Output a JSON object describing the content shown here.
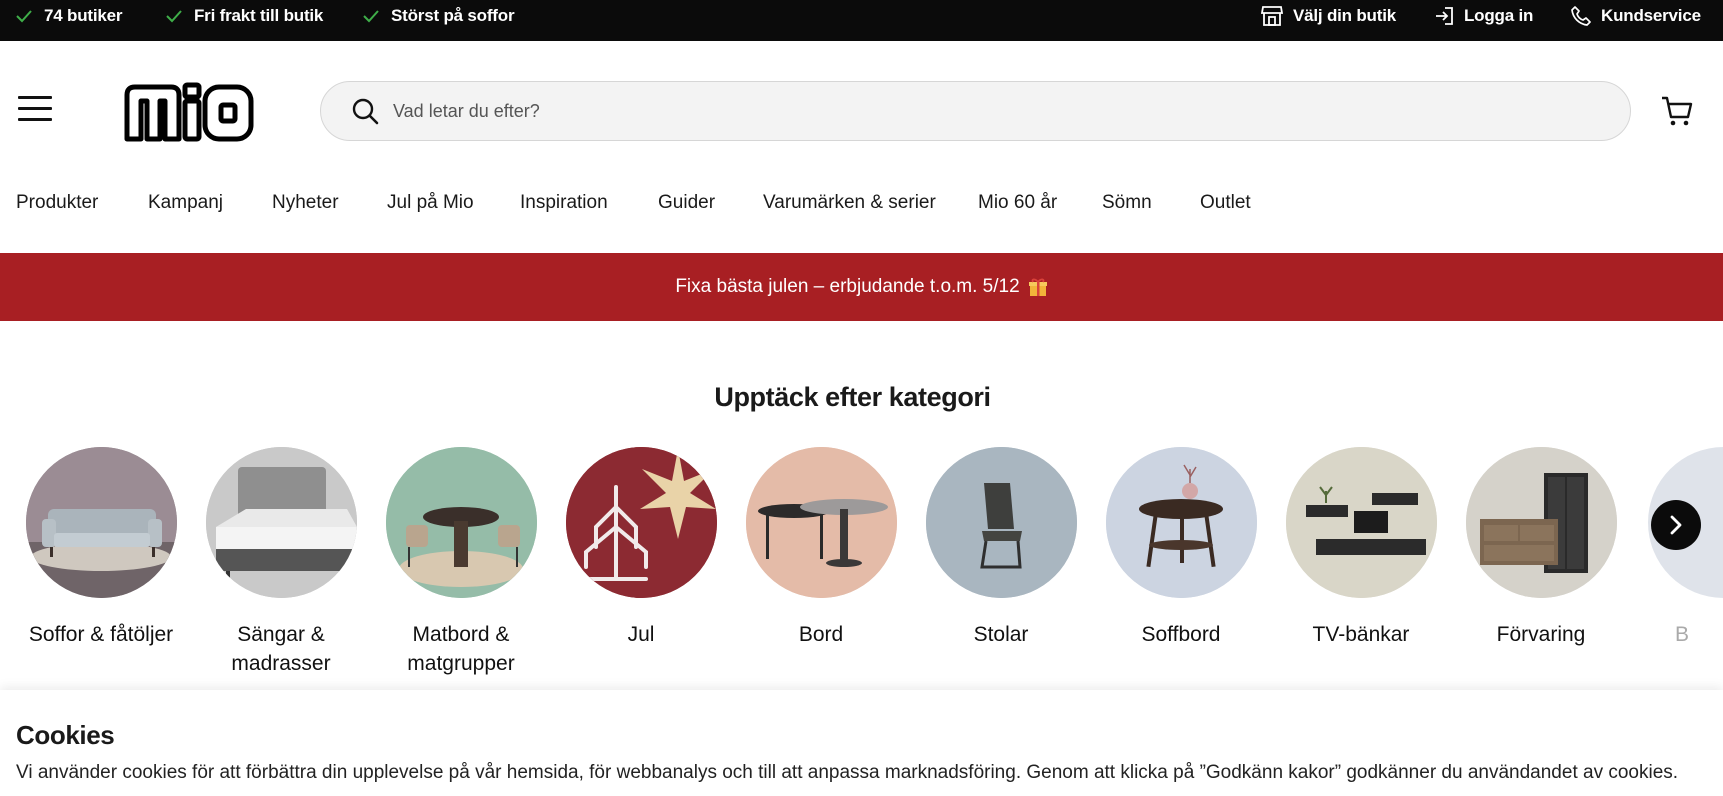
{
  "topbar": {
    "usps": [
      "74 butiker",
      "Fri frakt till butik",
      "Störst på soffor"
    ],
    "links": {
      "store": "Välj din butik",
      "login": "Logga in",
      "service": "Kundservice"
    }
  },
  "header": {
    "logo_text": "mio",
    "search_placeholder": "Vad letar du efter?"
  },
  "nav": {
    "items": [
      "Produkter",
      "Kampanj",
      "Nyheter",
      "Jul på Mio",
      "Inspiration",
      "Guider",
      "Varumärken & serier",
      "Mio 60 år",
      "Sömn",
      "Outlet"
    ]
  },
  "promo": {
    "text": "Fixa bästa julen – erbjudande t.o.m. 5/12"
  },
  "categories": {
    "title": "Upptäck efter kategori",
    "items": [
      {
        "label": "Soffor & fåtöljer"
      },
      {
        "label": "Sängar & madrasser"
      },
      {
        "label": "Matbord & matgrupper"
      },
      {
        "label": "Jul"
      },
      {
        "label": "Bord"
      },
      {
        "label": "Stolar"
      },
      {
        "label": "Soffbord"
      },
      {
        "label": "TV-bänkar"
      },
      {
        "label": "Förvaring"
      },
      {
        "label": "B"
      }
    ]
  },
  "cookies": {
    "title": "Cookies",
    "text": "Vi använder cookies för att förbättra din upplevelse på vår hemsida, för webbanalys och till att anpassa marknadsföring. Genom att klicka på ”Godkänn kakor” godkänner du användandet av cookies."
  },
  "colors": {
    "topbar": "#0b0b0b",
    "promo": "#a81f23",
    "search_bg": "#f3f3f3",
    "check": "#3fae49"
  }
}
